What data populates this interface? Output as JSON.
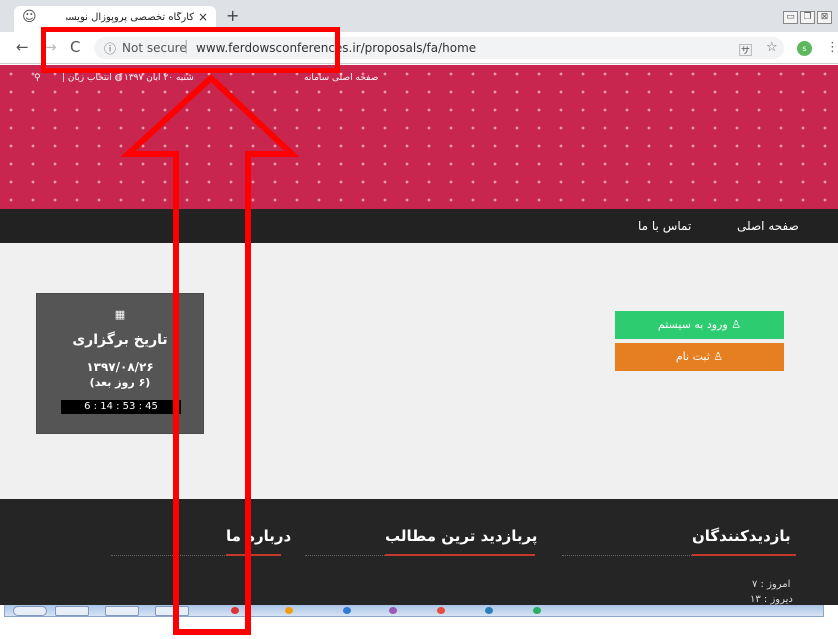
{
  "browser": {
    "tab_title": "کارگاه تخصصی پروپوزال نویسی",
    "tab_close": "×",
    "new_tab": "+",
    "window_controls": [
      "▭",
      "❐",
      "⊠"
    ],
    "security_label": "Not secure",
    "url_visible": "www.ferdowsconferences.ir/proposals/fa/home",
    "profile_initial": "s"
  },
  "site": {
    "top_bar": {
      "home_system": "صفحه اصلی سامانه",
      "date_text": "شنبه ۲۰ آبان ۱۳۹۷",
      "language": "انتخاب زبان",
      "separator": "|"
    },
    "menu": [
      "صفحه اصلی",
      "تماس با ما"
    ],
    "event": {
      "label": "تاریخ برگزاری",
      "date": "۱۳۹۷/۰۸/۲۶",
      "remaining": "(۶ روز بعد)",
      "countdown": "6 : 14 : 53 : 45"
    },
    "actions": {
      "login": "ورود به سیستم",
      "register": "ثبت نام"
    },
    "footer": {
      "visitors_title": "بازدیدکنندگان",
      "popular_title": "پربازدید ترین مطالب",
      "about_title": "درباره ما",
      "today": "امروز : ۷",
      "yesterday": "دیروز : ۱۳"
    }
  },
  "colors": {
    "banner": "#c8264f",
    "menu": "#222222",
    "login": "#2ecc71",
    "register": "#e67e22",
    "annotation": "#ff0000"
  }
}
